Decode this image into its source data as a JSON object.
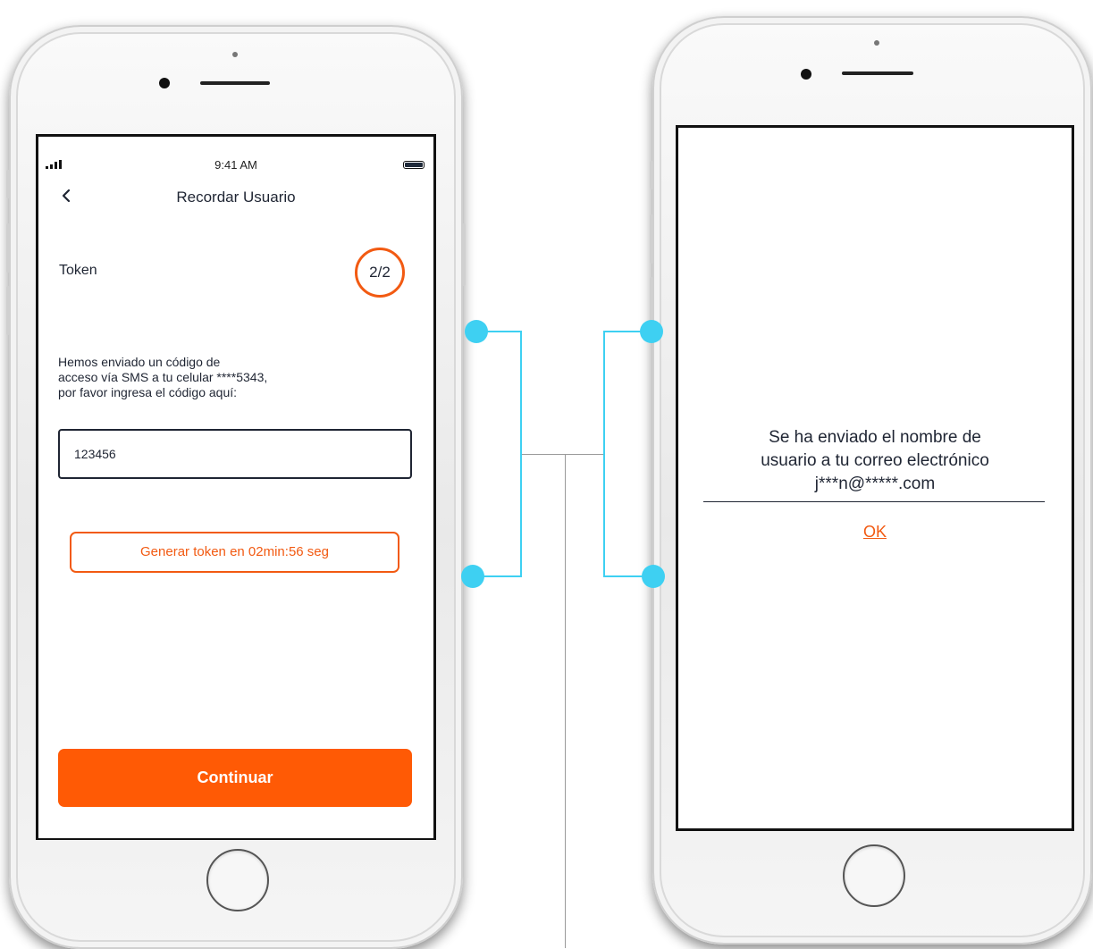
{
  "left_phone": {
    "status": {
      "time": "9:41 AM"
    },
    "nav": {
      "title": "Recordar Usuario"
    },
    "step": {
      "label": "Token",
      "indicator": "2/2"
    },
    "instructions": "Hemos enviado un código de\nacceso vía SMS a tu celular ****5343,\npor favor  ingresa el código aquí:",
    "token_input": {
      "value": "123456"
    },
    "generate_token_button": "Generar token en 02min:56 seg",
    "continue_button": "Continuar"
  },
  "right_phone": {
    "dialog": {
      "message": "Se ha enviado el nombre de\nusuario a tu correo electrónico\nj***n@*****.com",
      "ok_label": "OK"
    }
  },
  "colors": {
    "accent_orange": "#ff5a05",
    "connector_cyan": "#3ed0f2",
    "text_dark": "#1f2533"
  },
  "icons": {
    "back": "chevron-left-icon",
    "signal": "signal-bars-icon",
    "battery": "battery-icon"
  }
}
